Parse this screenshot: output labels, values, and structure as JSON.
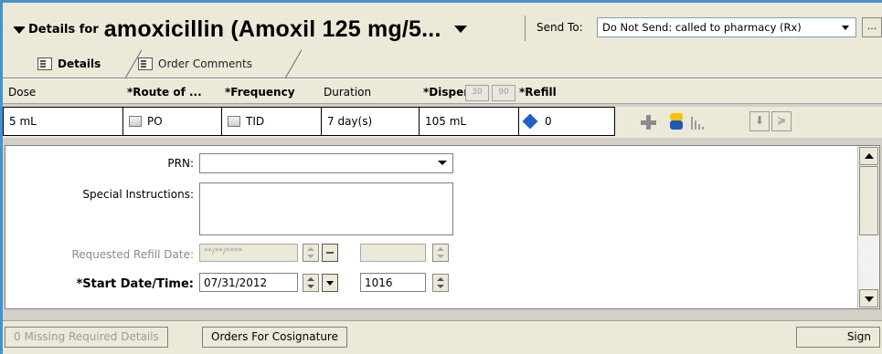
{
  "header": {
    "details_for_label": "Details for",
    "drug_title": "amoxicillin (Amoxil 125 mg/5...",
    "send_to_label": "Send To:",
    "send_to_value": "Do Not Send: called to pharmacy (Rx)",
    "more_label": "...",
    "tabs": [
      {
        "label": "Details",
        "active": true,
        "icon": "details-icon"
      },
      {
        "label": "Order Comments",
        "active": false,
        "icon": "comments-icon"
      }
    ]
  },
  "grid": {
    "columns": [
      {
        "label": "Dose",
        "required": false
      },
      {
        "label": "*Route of ...",
        "required": true
      },
      {
        "label": "*Frequency",
        "required": true
      },
      {
        "label": "Duration",
        "required": false
      },
      {
        "label": "*Dispense",
        "required": true
      },
      {
        "label": "*Refill",
        "required": true
      }
    ],
    "dispense_buttons": [
      "30",
      "90"
    ],
    "row": {
      "dose": "5 mL",
      "route": "PO",
      "frequency": "TID",
      "duration": "7 day(s)",
      "dispense": "105 mL",
      "refill": "0"
    },
    "toolbar_icons": [
      "plus-icon",
      "pill-icon",
      "bars-icon",
      "arrow-down-icon",
      "double-chevron-icon"
    ],
    "arrow_down_glyph": "⬇",
    "double_chevron_glyph": "≽"
  },
  "form": {
    "prn_label": "PRN:",
    "prn_value": "",
    "special_instructions_label": "Special Instructions:",
    "special_instructions_value": "",
    "requested_refill_label": "Requested Refill Date:",
    "requested_refill_placeholder": "**/**/****",
    "requested_refill_time": "",
    "start_label": "*Start Date/Time:",
    "start_date": "07/31/2012",
    "start_time": "1016"
  },
  "footer": {
    "missing_details": "0 Missing Required Details",
    "cosignature": "Orders For Cosignature",
    "sign": "Sign"
  },
  "colors": {
    "window_border": "#4a90c8",
    "background": "#ece9d8",
    "refill_diamond": "#1e63c4",
    "pill_top": "#f6c400",
    "pill_bottom": "#2159b8"
  }
}
